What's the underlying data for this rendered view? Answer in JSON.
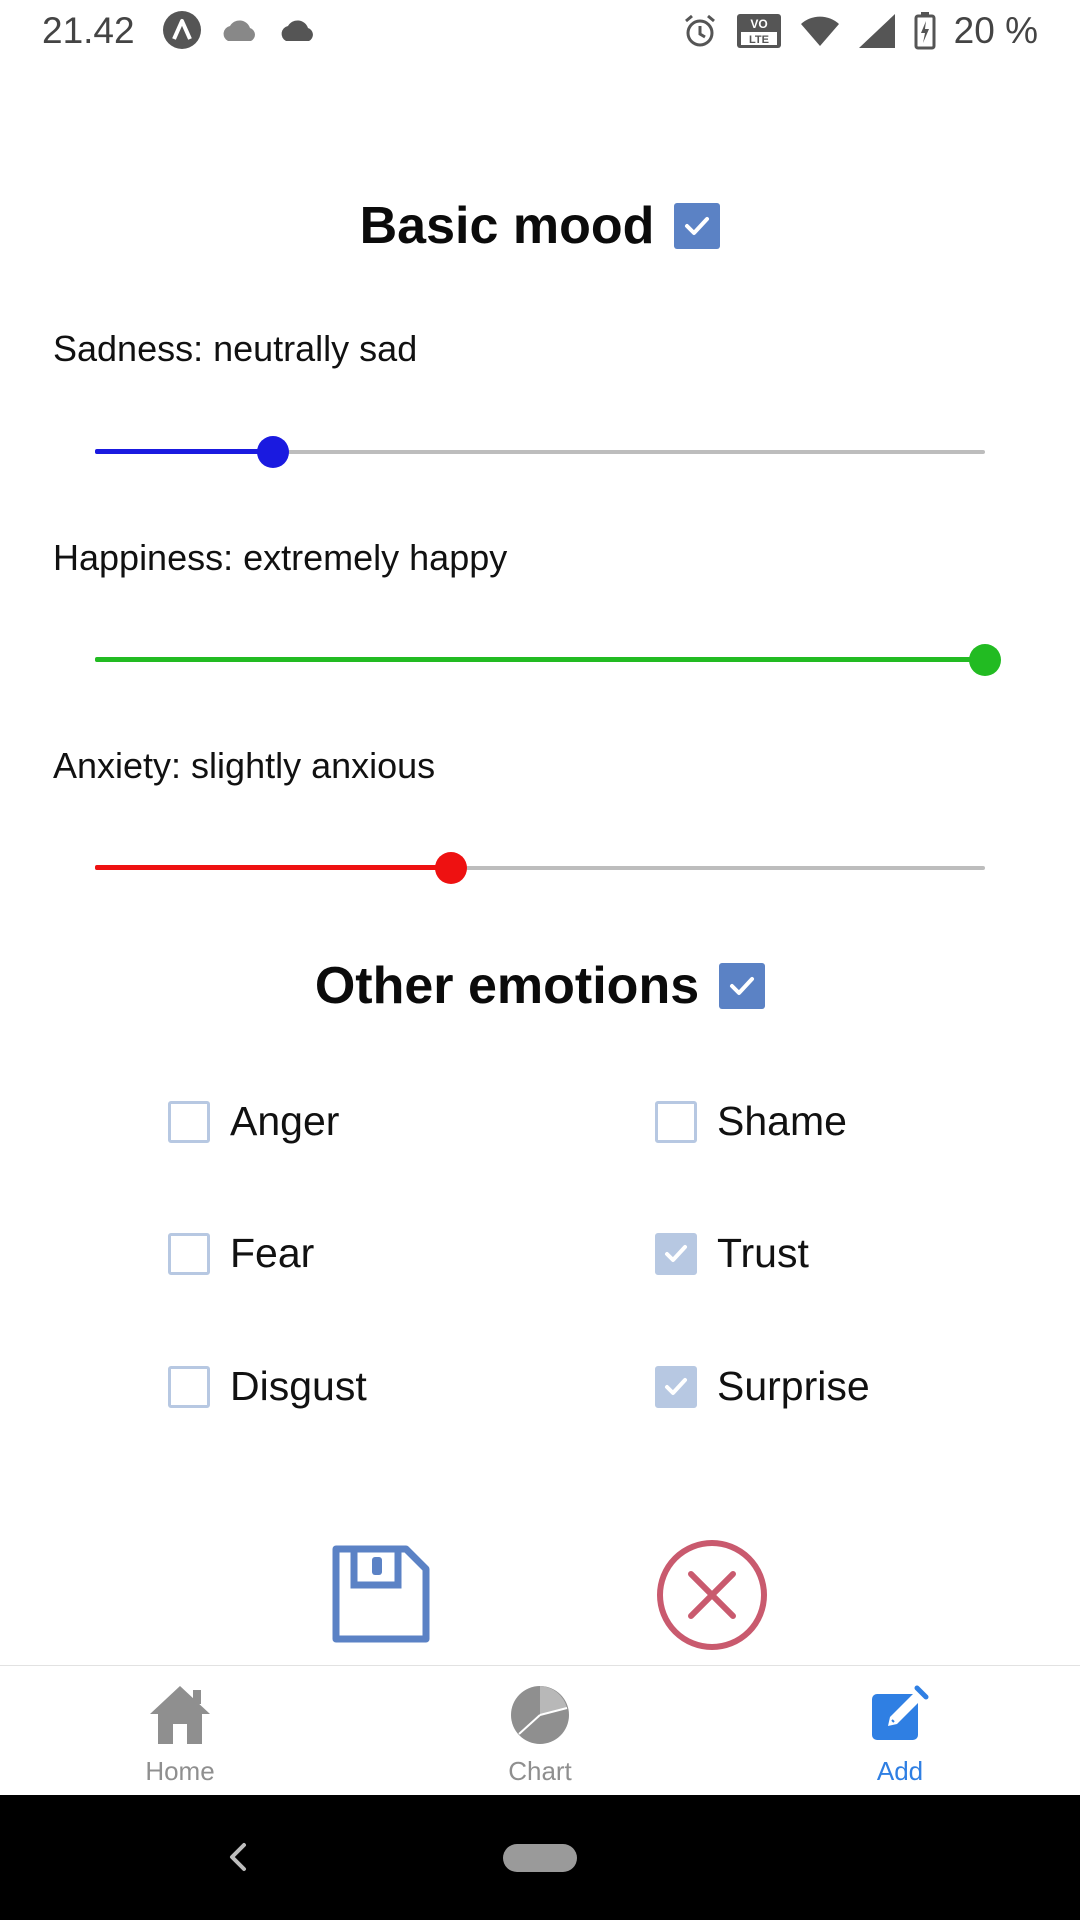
{
  "status_bar": {
    "time": "21.42",
    "battery": "20 %",
    "left_icons": [
      "app-a-icon",
      "cloud-gray-icon",
      "cloud-dark-icon"
    ],
    "right_icons": [
      "alarm-icon",
      "volte-icon",
      "wifi-icon",
      "signal-icon",
      "battery-charging-icon"
    ],
    "volte_text": "VO LTE"
  },
  "basic_mood": {
    "title": "Basic mood",
    "enabled": true,
    "sliders": [
      {
        "label": "Sadness: neutrally sad",
        "value": 0.2,
        "color": "#1a1ae0"
      },
      {
        "label": "Happiness: extremely happy",
        "value": 1.0,
        "color": "#22bb22"
      },
      {
        "label": "Anxiety: slightly anxious",
        "value": 0.4,
        "color": "#ee1111"
      }
    ]
  },
  "other_emotions": {
    "title": "Other emotions",
    "enabled": true,
    "items": [
      {
        "label": "Anger",
        "checked": false
      },
      {
        "label": "Shame",
        "checked": false
      },
      {
        "label": "Fear",
        "checked": false
      },
      {
        "label": "Trust",
        "checked": true
      },
      {
        "label": "Disgust",
        "checked": false
      },
      {
        "label": "Surprise",
        "checked": true
      }
    ]
  },
  "actions": {
    "save_icon": "floppy-disk-icon",
    "cancel_icon": "close-circle-icon",
    "save_color": "#5b82c5",
    "cancel_color": "#c95a6e"
  },
  "bottom_nav": {
    "items": [
      {
        "label": "Home",
        "icon": "home-icon",
        "active": false
      },
      {
        "label": "Chart",
        "icon": "pie-chart-icon",
        "active": false
      },
      {
        "label": "Add",
        "icon": "edit-icon",
        "active": true
      }
    ],
    "active_color": "#2f7fe3",
    "inactive_color": "#8f8f8f"
  }
}
